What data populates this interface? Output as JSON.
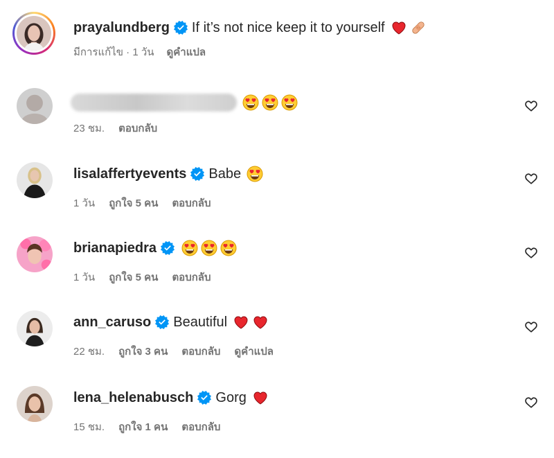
{
  "post": {
    "username": "prayalundberg",
    "caption": "If it’s not nice keep it to yourself",
    "caption_emojis": [
      "red-heart",
      "bandage"
    ],
    "meta": {
      "edited": "มีการแก้ไข · 1 วัน",
      "translate": "ดูคำแปล"
    }
  },
  "comments": [
    {
      "username": "",
      "username_hidden": true,
      "text": "",
      "emojis": [
        "heart-eyes",
        "heart-eyes",
        "heart-eyes"
      ],
      "time": "23 ชม.",
      "likes": "",
      "reply": "ตอบกลับ",
      "translate": ""
    },
    {
      "username": "lisalaffertyevents",
      "text": "Babe",
      "emojis": [
        "heart-eyes"
      ],
      "time": "1 วัน",
      "likes": "ถูกใจ 5 คน",
      "reply": "ตอบกลับ",
      "translate": ""
    },
    {
      "username": "brianapiedra",
      "text": "",
      "emojis": [
        "heart-eyes",
        "heart-eyes",
        "heart-eyes"
      ],
      "time": "1 วัน",
      "likes": "ถูกใจ 5 คน",
      "reply": "ตอบกลับ",
      "translate": ""
    },
    {
      "username": "ann_caruso",
      "text": "Beautiful",
      "emojis": [
        "red-heart",
        "red-heart"
      ],
      "time": "22 ชม.",
      "likes": "ถูกใจ 3 คน",
      "reply": "ตอบกลับ",
      "translate": "ดูคำแปล"
    },
    {
      "username": "lena_helenabusch",
      "text": "Gorg",
      "emojis": [
        "red-heart"
      ],
      "time": "15 ชม.",
      "likes": "ถูกใจ 1 คน",
      "reply": "ตอบกลับ",
      "translate": ""
    }
  ],
  "colors": {
    "verified": "#0095f6",
    "meta": "#737373",
    "text": "#262626"
  }
}
